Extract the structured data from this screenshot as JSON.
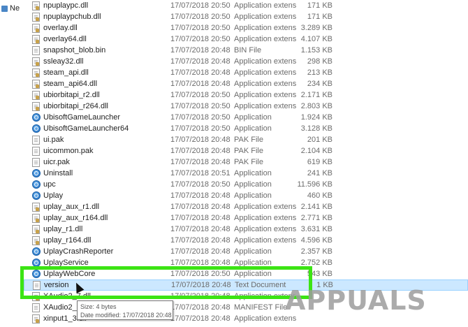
{
  "nav_pane": {
    "label": "Ne"
  },
  "files": [
    {
      "name": "npuplaypc.dll",
      "date": "17/07/2018 20:50",
      "type": "Application extens",
      "size": "171 KB",
      "icon": "dll-file-icon"
    },
    {
      "name": "npuplaypchub.dll",
      "date": "17/07/2018 20:50",
      "type": "Application extens",
      "size": "171 KB",
      "icon": "dll-file-icon"
    },
    {
      "name": "overlay.dll",
      "date": "17/07/2018 20:50",
      "type": "Application extens",
      "size": "3.289 KB",
      "icon": "dll-file-icon"
    },
    {
      "name": "overlay64.dll",
      "date": "17/07/2018 20:50",
      "type": "Application extens",
      "size": "4.107 KB",
      "icon": "dll-file-icon"
    },
    {
      "name": "snapshot_blob.bin",
      "date": "17/07/2018 20:48",
      "type": "BIN File",
      "size": "1.153 KB",
      "icon": "file-icon"
    },
    {
      "name": "ssleay32.dll",
      "date": "17/07/2018 20:48",
      "type": "Application extens",
      "size": "298 KB",
      "icon": "dll-file-icon"
    },
    {
      "name": "steam_api.dll",
      "date": "17/07/2018 20:48",
      "type": "Application extens",
      "size": "213 KB",
      "icon": "dll-file-icon"
    },
    {
      "name": "steam_api64.dll",
      "date": "17/07/2018 20:48",
      "type": "Application extens",
      "size": "234 KB",
      "icon": "dll-file-icon"
    },
    {
      "name": "ubiorbitapi_r2.dll",
      "date": "17/07/2018 20:50",
      "type": "Application extens",
      "size": "2.171 KB",
      "icon": "dll-file-icon"
    },
    {
      "name": "ubiorbitapi_r264.dll",
      "date": "17/07/2018 20:50",
      "type": "Application extens",
      "size": "2.803 KB",
      "icon": "dll-file-icon"
    },
    {
      "name": "UbisoftGameLauncher",
      "date": "17/07/2018 20:50",
      "type": "Application",
      "size": "1.924 KB",
      "icon": "app-icon"
    },
    {
      "name": "UbisoftGameLauncher64",
      "date": "17/07/2018 20:50",
      "type": "Application",
      "size": "3.128 KB",
      "icon": "app-icon"
    },
    {
      "name": "ui.pak",
      "date": "17/07/2018 20:48",
      "type": "PAK File",
      "size": "201 KB",
      "icon": "file-icon"
    },
    {
      "name": "uicommon.pak",
      "date": "17/07/2018 20:48",
      "type": "PAK File",
      "size": "2.104 KB",
      "icon": "file-icon"
    },
    {
      "name": "uicr.pak",
      "date": "17/07/2018 20:48",
      "type": "PAK File",
      "size": "619 KB",
      "icon": "file-icon"
    },
    {
      "name": "Uninstall",
      "date": "17/07/2018 20:51",
      "type": "Application",
      "size": "241 KB",
      "icon": "app-icon"
    },
    {
      "name": "upc",
      "date": "17/07/2018 20:50",
      "type": "Application",
      "size": "11.596 KB",
      "icon": "app-icon"
    },
    {
      "name": "Uplay",
      "date": "17/07/2018 20:48",
      "type": "Application",
      "size": "460 KB",
      "icon": "app-icon"
    },
    {
      "name": "uplay_aux_r1.dll",
      "date": "17/07/2018 20:48",
      "type": "Application extens",
      "size": "2.141 KB",
      "icon": "dll-file-icon"
    },
    {
      "name": "uplay_aux_r164.dll",
      "date": "17/07/2018 20:48",
      "type": "Application extens",
      "size": "2.771 KB",
      "icon": "dll-file-icon"
    },
    {
      "name": "uplay_r1.dll",
      "date": "17/07/2018 20:48",
      "type": "Application extens",
      "size": "3.631 KB",
      "icon": "dll-file-icon"
    },
    {
      "name": "uplay_r164.dll",
      "date": "17/07/2018 20:48",
      "type": "Application extens",
      "size": "4.596 KB",
      "icon": "dll-file-icon"
    },
    {
      "name": "UplayCrashReporter",
      "date": "17/07/2018 20:48",
      "type": "Application",
      "size": "2.357 KB",
      "icon": "app-icon"
    },
    {
      "name": "UplayService",
      "date": "17/07/2018 20:48",
      "type": "Application",
      "size": "2.752 KB",
      "icon": "app-icon"
    },
    {
      "name": "UplayWebCore",
      "date": "17/07/2018 20:50",
      "type": "Application",
      "size": "543 KB",
      "icon": "app-icon"
    },
    {
      "name": "version",
      "date": "17/07/2018 20:48",
      "type": "Text Document",
      "size": "1 KB",
      "icon": "text-file-icon"
    },
    {
      "name": "XAudio2_7.dll",
      "date": "17/07/2018 20:48",
      "type": "Application extens",
      "size": "",
      "icon": "dll-file-icon"
    },
    {
      "name": "XAudio2_7.dll",
      "date": "17/07/2018 20:48",
      "type": "MANIFEST File",
      "size": "",
      "icon": "file-icon"
    },
    {
      "name": "xinput1_3.dll",
      "date": "17/07/2018 20:48",
      "type": "Application extens",
      "size": "",
      "icon": "dll-file-icon"
    }
  ],
  "selected_file": "version",
  "tooltip": {
    "size_line": "Size: 4 bytes",
    "date_line": "Date modified: 17/07/2018 20:48"
  },
  "watermark": "APPUALS",
  "colors": {
    "highlight_border": "#3ce414",
    "selection_bg": "#cce8ff",
    "secondary_text": "#6b6b6b"
  }
}
